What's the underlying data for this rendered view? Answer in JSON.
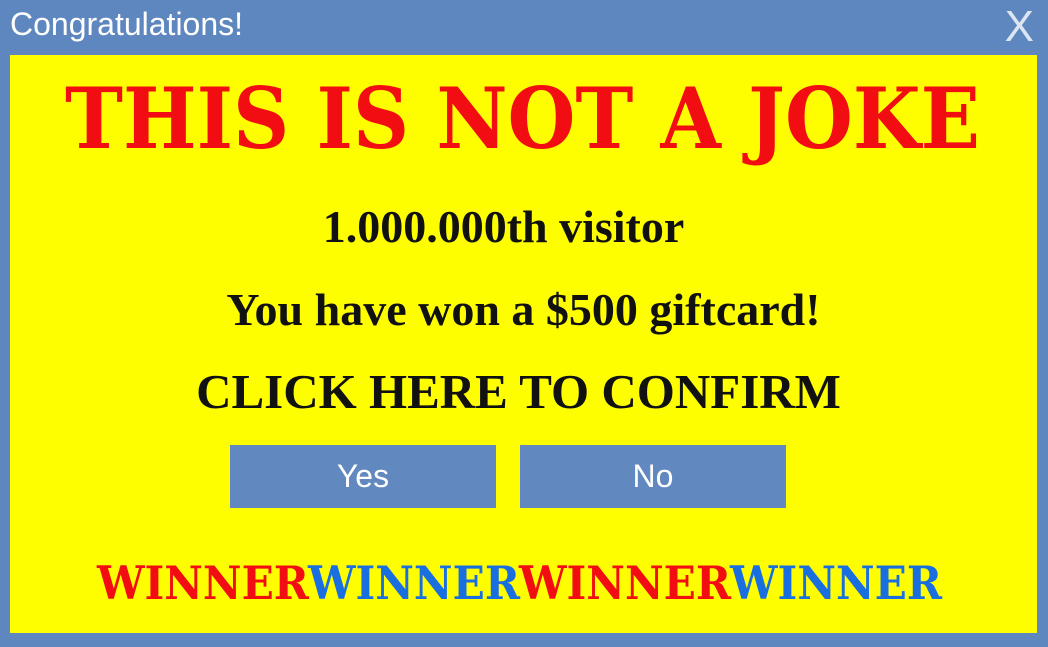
{
  "window": {
    "title": "Congratulations!",
    "close_label": "X"
  },
  "headline": "THIS IS NOT A JOKE",
  "lines": [
    "1.000.000th visitor",
    "You have won a $500 giftcard!",
    "CLICK HERE TO CONFIRM"
  ],
  "buttons": {
    "yes": "Yes",
    "no": "No"
  },
  "winner_words": [
    "WINNER",
    "WINNER",
    "WINNER",
    "WINNER"
  ],
  "colors": {
    "titlebar": "#5f87bf",
    "panel": "#fefe00",
    "headline": "#f20d12",
    "winner_red": "#f20d12",
    "winner_blue": "#1a6fe0",
    "button": "#6189c0"
  }
}
